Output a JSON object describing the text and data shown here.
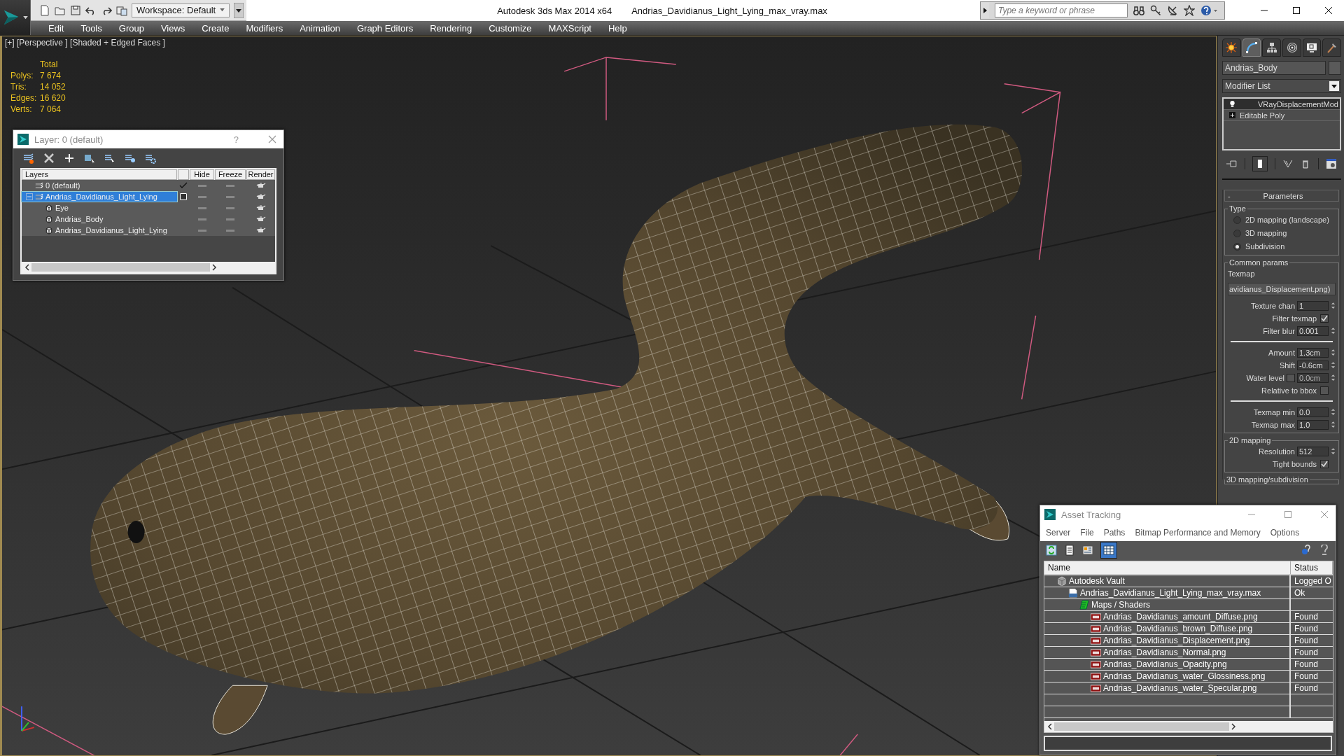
{
  "title_bar": {
    "workspace": "Workspace: Default",
    "app_title": "Autodesk 3ds Max  2014 x64",
    "file_title": "Andrias_Davidianus_Light_Lying_max_vray.max",
    "search": {
      "placeholder": "Type a keyword or phrase"
    }
  },
  "menu": [
    "Edit",
    "Tools",
    "Group",
    "Views",
    "Create",
    "Modifiers",
    "Animation",
    "Graph Editors",
    "Rendering",
    "Customize",
    "MAXScript",
    "Help"
  ],
  "viewport": {
    "label": "[+] [Perspective ] [Shaded + Edged Faces ]",
    "stats": {
      "heading": "Total",
      "rows": [
        {
          "label": "Polys:",
          "value": "7 674"
        },
        {
          "label": "Tris:",
          "value": "14 052"
        },
        {
          "label": "Edges:",
          "value": "16 620"
        },
        {
          "label": "Verts:",
          "value": "7 064"
        }
      ]
    }
  },
  "layer_window": {
    "title": "Layer: 0 (default)",
    "help": "?",
    "columns": [
      "Layers",
      "Hide",
      "Freeze",
      "Render"
    ],
    "layers": [
      {
        "name": "0 (default)",
        "kind": "layer",
        "current": true,
        "selected": false
      },
      {
        "name": "Andrias_Davidianus_Light_Lying",
        "kind": "layer",
        "current": false,
        "selected": true,
        "expanded": true,
        "children": [
          {
            "name": "Eye",
            "kind": "object",
            "selected": false
          },
          {
            "name": "Andrias_Body",
            "kind": "object",
            "selected": false
          },
          {
            "name": "Andrias_Davidianus_Light_Lying",
            "kind": "object",
            "selected": false
          }
        ]
      }
    ]
  },
  "command_panel": {
    "tabs": [
      {
        "kind": "sun",
        "selected": false
      },
      {
        "kind": "arc",
        "selected": true
      },
      {
        "kind": "tree",
        "selected": false
      },
      {
        "kind": "rings",
        "selected": false
      },
      {
        "kind": "monitor",
        "selected": false
      },
      {
        "kind": "hammer",
        "selected": false
      }
    ],
    "object_name": "Andrias_Body",
    "modifier_list": "Modifier List",
    "stack": [
      {
        "name": "VRayDisplacementMod",
        "kind": "modifier",
        "selected": true
      },
      {
        "name": "Editable Poly",
        "kind": "base",
        "selected": false
      }
    ],
    "parameters": {
      "title": "Parameters",
      "collapse": "-",
      "type_group": {
        "title": "Type",
        "options": [
          {
            "label": "2D mapping (landscape)",
            "selected": false
          },
          {
            "label": "3D mapping",
            "selected": false
          },
          {
            "label": "Subdivision",
            "selected": true
          }
        ]
      },
      "common_params": {
        "title": "Common params",
        "texmap_label": "Texmap",
        "texmap": "avidianus_Displacement.png)",
        "controls": [
          {
            "kind": "spinner",
            "label": "Texture chan",
            "value": "1"
          },
          {
            "kind": "checkbox",
            "label": "Filter texmap",
            "checked": true
          },
          {
            "kind": "spinner",
            "label": "Filter blur",
            "value": "0.001"
          },
          {
            "kind": "separator"
          },
          {
            "kind": "spinner",
            "label": "Amount",
            "value": "1.3cm"
          },
          {
            "kind": "spinner",
            "label": "Shift",
            "value": "-0.6cm"
          },
          {
            "kind": "check_spinner",
            "label": "Water level",
            "checked": false,
            "value": "0.0cm"
          },
          {
            "kind": "checkbox",
            "label": "Relative to bbox",
            "checked": false
          },
          {
            "kind": "separator"
          },
          {
            "kind": "spinner",
            "label": "Texmap min",
            "value": "0.0"
          },
          {
            "kind": "spinner",
            "label": "Texmap max",
            "value": "1.0"
          }
        ]
      },
      "mapping_2d": {
        "title": "2D mapping",
        "controls": [
          {
            "kind": "spinner",
            "label": "Resolution",
            "value": "512"
          },
          {
            "kind": "checkbox",
            "label": "Tight bounds",
            "checked": true
          }
        ]
      },
      "mapping_3d": {
        "title": "3D mapping/subdivision"
      }
    }
  },
  "asset_tracking": {
    "title": "Asset Tracking",
    "menu": [
      "Server",
      "File",
      "Paths",
      "Bitmap Performance and Memory",
      "Options"
    ],
    "columns": [
      "Name",
      "Status"
    ],
    "rows": [
      {
        "name": "Autodesk Vault",
        "kind": "vault",
        "status": "Logged O",
        "children": [
          {
            "name": "Andrias_Davidianus_Light_Lying_max_vray.max",
            "kind": "max",
            "status": "Ok",
            "children": [
              {
                "name": "Maps / Shaders",
                "kind": "folder",
                "children": [
                  {
                    "name": "Andrias_Davidianus_amount_Diffuse.png",
                    "kind": "png",
                    "status": "Found"
                  },
                  {
                    "name": "Andrias_Davidianus_brown_Diffuse.png",
                    "kind": "png",
                    "status": "Found"
                  },
                  {
                    "name": "Andrias_Davidianus_Displacement.png",
                    "kind": "png",
                    "status": "Found"
                  },
                  {
                    "name": "Andrias_Davidianus_Normal.png",
                    "kind": "png",
                    "status": "Found"
                  },
                  {
                    "name": "Andrias_Davidianus_Opacity.png",
                    "kind": "png",
                    "status": "Found"
                  },
                  {
                    "name": "Andrias_Davidianus_water_Glossiness.png",
                    "kind": "png",
                    "status": "Found"
                  },
                  {
                    "name": "Andrias_Davidianus_water_Specular.png",
                    "kind": "png",
                    "status": "Found"
                  }
                ]
              }
            ]
          }
        ]
      }
    ]
  }
}
